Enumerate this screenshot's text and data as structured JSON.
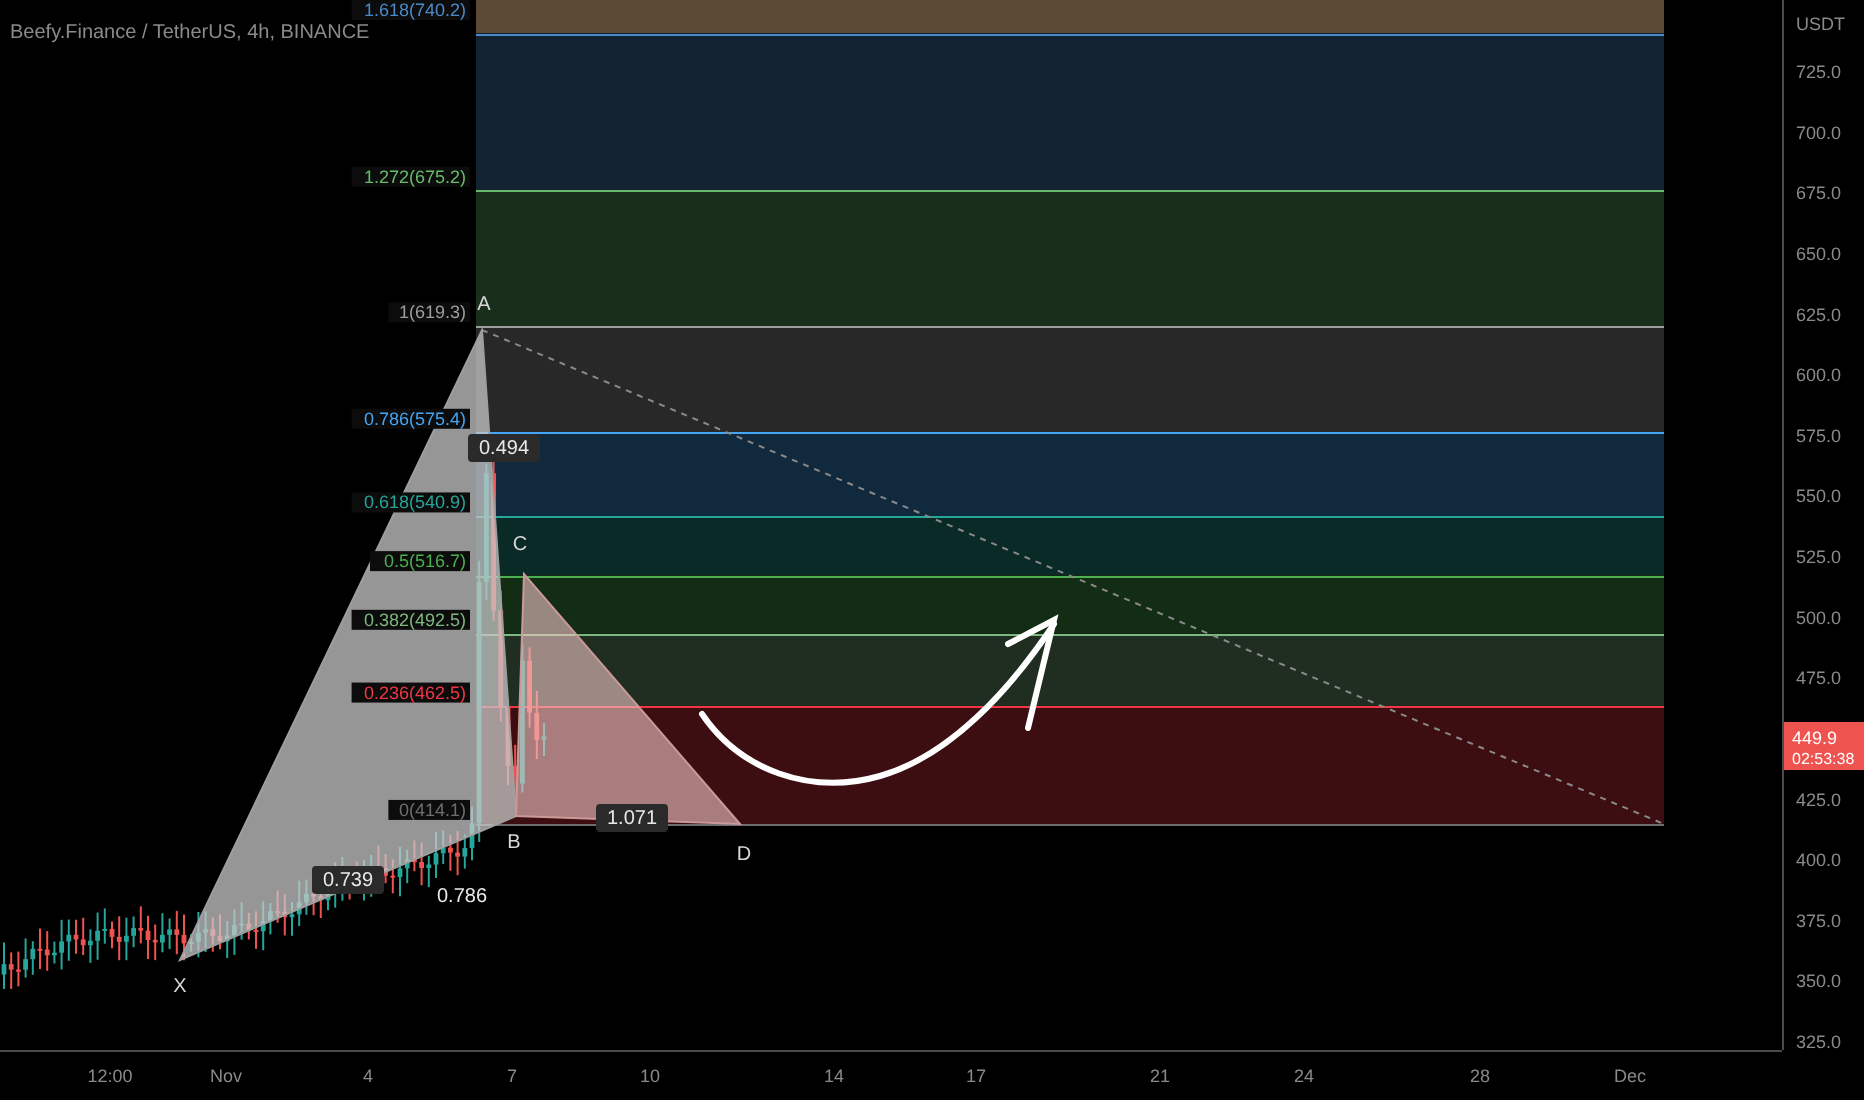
{
  "chart": {
    "title": "Beefy.Finance / TetherUS, 4h, BINANCE",
    "fib_levels": [
      {
        "label": "1.618(740.2)",
        "color": "#4a8ac8"
      },
      {
        "label": "1.272(675.2)",
        "color": "#66bb6a"
      },
      {
        "label": "1(619.3)",
        "color": "#9e9e9e"
      },
      {
        "label": "0.786(575.4)",
        "color": "#42a5f5"
      },
      {
        "label": "0.618(540.9)",
        "color": "#26a69a"
      },
      {
        "label": "0.5(516.7)",
        "color": "#4caf50"
      },
      {
        "label": "0.382(492.5)",
        "color": "#7cb87f"
      },
      {
        "label": "0.236(462.5)",
        "color": "#f23645"
      },
      {
        "label": "0(414.1)",
        "color": "#6e6e6e"
      }
    ],
    "pattern": {
      "points": [
        {
          "label": "X"
        },
        {
          "label": "A"
        },
        {
          "label": "B"
        },
        {
          "label": "C"
        },
        {
          "label": "D"
        }
      ],
      "ratios": [
        {
          "label": "0.739",
          "boxed": true
        },
        {
          "label": "0.786",
          "boxed": false
        },
        {
          "label": "0.494",
          "boxed": true
        },
        {
          "label": "1.071",
          "boxed": true
        }
      ]
    }
  },
  "price_axis": {
    "unit": "USDT",
    "labels": [
      "725.0",
      "700.0",
      "675.0",
      "650.0",
      "625.0",
      "600.0",
      "575.0",
      "550.0",
      "525.0",
      "500.0",
      "475.0",
      "425.0",
      "400.0",
      "375.0",
      "350.0",
      "325.0"
    ],
    "price_tag": {
      "price": "449.9",
      "countdown": "02:53:38"
    }
  },
  "time_axis": {
    "labels": [
      "12:00",
      "Nov",
      "4",
      "7",
      "10",
      "14",
      "17",
      "21",
      "24",
      "28",
      "Dec"
    ]
  }
}
